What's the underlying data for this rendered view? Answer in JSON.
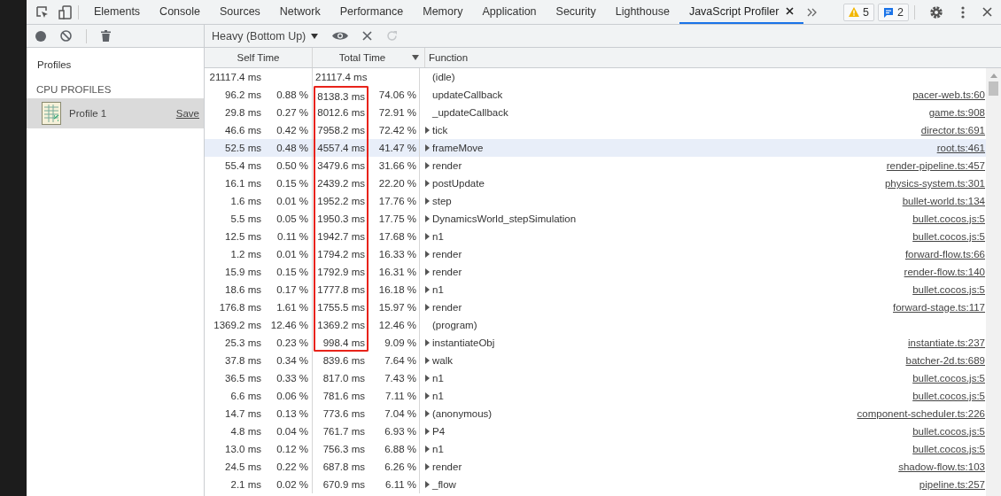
{
  "tabs": [
    {
      "label": "Elements",
      "selected": false
    },
    {
      "label": "Console",
      "selected": false
    },
    {
      "label": "Sources",
      "selected": false
    },
    {
      "label": "Network",
      "selected": false
    },
    {
      "label": "Performance",
      "selected": false
    },
    {
      "label": "Memory",
      "selected": false
    },
    {
      "label": "Application",
      "selected": false
    },
    {
      "label": "Security",
      "selected": false
    },
    {
      "label": "Lighthouse",
      "selected": false
    },
    {
      "label": "JavaScript Profiler",
      "selected": true
    }
  ],
  "badges": [
    {
      "kind": "warning",
      "count": "5"
    },
    {
      "kind": "message",
      "count": "2"
    }
  ],
  "view_select": "Heavy (Bottom Up)",
  "sidebar": {
    "title": "Profiles",
    "section": "CPU PROFILES",
    "items": [
      {
        "label": "Profile 1",
        "action": "Save",
        "selected": true
      }
    ]
  },
  "table": {
    "columns": [
      "Self Time",
      "Total Time",
      "Function"
    ],
    "rows": [
      {
        "self": "21117.4 ms",
        "self_pct": "",
        "total": "21117.4 ms",
        "total_pct": "",
        "function": "(idle)",
        "expandable": false,
        "url": "",
        "selected": false,
        "highlighted": false
      },
      {
        "self": "96.2 ms",
        "self_pct": "0.88 %",
        "total": "8138.3 ms",
        "total_pct": "74.06 %",
        "function": "updateCallback",
        "expandable": false,
        "url": "pacer-web.ts:60",
        "selected": false,
        "highlighted": true
      },
      {
        "self": "29.8 ms",
        "self_pct": "0.27 %",
        "total": "8012.6 ms",
        "total_pct": "72.91 %",
        "function": "_updateCallback",
        "expandable": false,
        "url": "game.ts:908",
        "selected": false,
        "highlighted": true
      },
      {
        "self": "46.6 ms",
        "self_pct": "0.42 %",
        "total": "7958.2 ms",
        "total_pct": "72.42 %",
        "function": "tick",
        "expandable": true,
        "url": "director.ts:691",
        "selected": false,
        "highlighted": true
      },
      {
        "self": "52.5 ms",
        "self_pct": "0.48 %",
        "total": "4557.4 ms",
        "total_pct": "41.47 %",
        "function": "frameMove",
        "expandable": true,
        "url": "root.ts:461",
        "selected": true,
        "highlighted": true
      },
      {
        "self": "55.4 ms",
        "self_pct": "0.50 %",
        "total": "3479.6 ms",
        "total_pct": "31.66 %",
        "function": "render",
        "expandable": true,
        "url": "render-pipeline.ts:457",
        "selected": false,
        "highlighted": true
      },
      {
        "self": "16.1 ms",
        "self_pct": "0.15 %",
        "total": "2439.2 ms",
        "total_pct": "22.20 %",
        "function": "postUpdate",
        "expandable": true,
        "url": "physics-system.ts:301",
        "selected": false,
        "highlighted": true
      },
      {
        "self": "1.6 ms",
        "self_pct": "0.01 %",
        "total": "1952.2 ms",
        "total_pct": "17.76 %",
        "function": "step",
        "expandable": true,
        "url": "bullet-world.ts:134",
        "selected": false,
        "highlighted": true
      },
      {
        "self": "5.5 ms",
        "self_pct": "0.05 %",
        "total": "1950.3 ms",
        "total_pct": "17.75 %",
        "function": "DynamicsWorld_stepSimulation",
        "expandable": true,
        "url": "bullet.cocos.js:5",
        "selected": false,
        "highlighted": true
      },
      {
        "self": "12.5 ms",
        "self_pct": "0.11 %",
        "total": "1942.7 ms",
        "total_pct": "17.68 %",
        "function": "n1",
        "expandable": true,
        "url": "bullet.cocos.js:5",
        "selected": false,
        "highlighted": true
      },
      {
        "self": "1.2 ms",
        "self_pct": "0.01 %",
        "total": "1794.2 ms",
        "total_pct": "16.33 %",
        "function": "render",
        "expandable": true,
        "url": "forward-flow.ts:66",
        "selected": false,
        "highlighted": true
      },
      {
        "self": "15.9 ms",
        "self_pct": "0.15 %",
        "total": "1792.9 ms",
        "total_pct": "16.31 %",
        "function": "render",
        "expandable": true,
        "url": "render-flow.ts:140",
        "selected": false,
        "highlighted": true
      },
      {
        "self": "18.6 ms",
        "self_pct": "0.17 %",
        "total": "1777.8 ms",
        "total_pct": "16.18 %",
        "function": "n1",
        "expandable": true,
        "url": "bullet.cocos.js:5",
        "selected": false,
        "highlighted": true
      },
      {
        "self": "176.8 ms",
        "self_pct": "1.61 %",
        "total": "1755.5 ms",
        "total_pct": "15.97 %",
        "function": "render",
        "expandable": true,
        "url": "forward-stage.ts:117",
        "selected": false,
        "highlighted": true
      },
      {
        "self": "1369.2 ms",
        "self_pct": "12.46 %",
        "total": "1369.2 ms",
        "total_pct": "12.46 %",
        "function": "(program)",
        "expandable": false,
        "url": "",
        "selected": false,
        "highlighted": true
      },
      {
        "self": "25.3 ms",
        "self_pct": "0.23 %",
        "total": "998.4 ms",
        "total_pct": "9.09 %",
        "function": "instantiateObj",
        "expandable": true,
        "url": "instantiate.ts:237",
        "selected": false,
        "highlighted": true
      },
      {
        "self": "37.8 ms",
        "self_pct": "0.34 %",
        "total": "839.6 ms",
        "total_pct": "7.64 %",
        "function": "walk",
        "expandable": true,
        "url": "batcher-2d.ts:689",
        "selected": false,
        "highlighted": false
      },
      {
        "self": "36.5 ms",
        "self_pct": "0.33 %",
        "total": "817.0 ms",
        "total_pct": "7.43 %",
        "function": "n1",
        "expandable": true,
        "url": "bullet.cocos.js:5",
        "selected": false,
        "highlighted": false
      },
      {
        "self": "6.6 ms",
        "self_pct": "0.06 %",
        "total": "781.6 ms",
        "total_pct": "7.11 %",
        "function": "n1",
        "expandable": true,
        "url": "bullet.cocos.js:5",
        "selected": false,
        "highlighted": false
      },
      {
        "self": "14.7 ms",
        "self_pct": "0.13 %",
        "total": "773.6 ms",
        "total_pct": "7.04 %",
        "function": "(anonymous)",
        "expandable": true,
        "url": "component-scheduler.ts:226",
        "selected": false,
        "highlighted": false
      },
      {
        "self": "4.8 ms",
        "self_pct": "0.04 %",
        "total": "761.7 ms",
        "total_pct": "6.93 %",
        "function": "P4",
        "expandable": true,
        "url": "bullet.cocos.js:5",
        "selected": false,
        "highlighted": false
      },
      {
        "self": "13.0 ms",
        "self_pct": "0.12 %",
        "total": "756.3 ms",
        "total_pct": "6.88 %",
        "function": "n1",
        "expandable": true,
        "url": "bullet.cocos.js:5",
        "selected": false,
        "highlighted": false
      },
      {
        "self": "24.5 ms",
        "self_pct": "0.22 %",
        "total": "687.8 ms",
        "total_pct": "6.26 %",
        "function": "render",
        "expandable": true,
        "url": "shadow-flow.ts:103",
        "selected": false,
        "highlighted": false
      },
      {
        "self": "2.1 ms",
        "self_pct": "0.02 %",
        "total": "670.9 ms",
        "total_pct": "6.11 %",
        "function": "_flow",
        "expandable": true,
        "url": "pipeline.ts:257",
        "selected": false,
        "highlighted": false
      }
    ]
  }
}
